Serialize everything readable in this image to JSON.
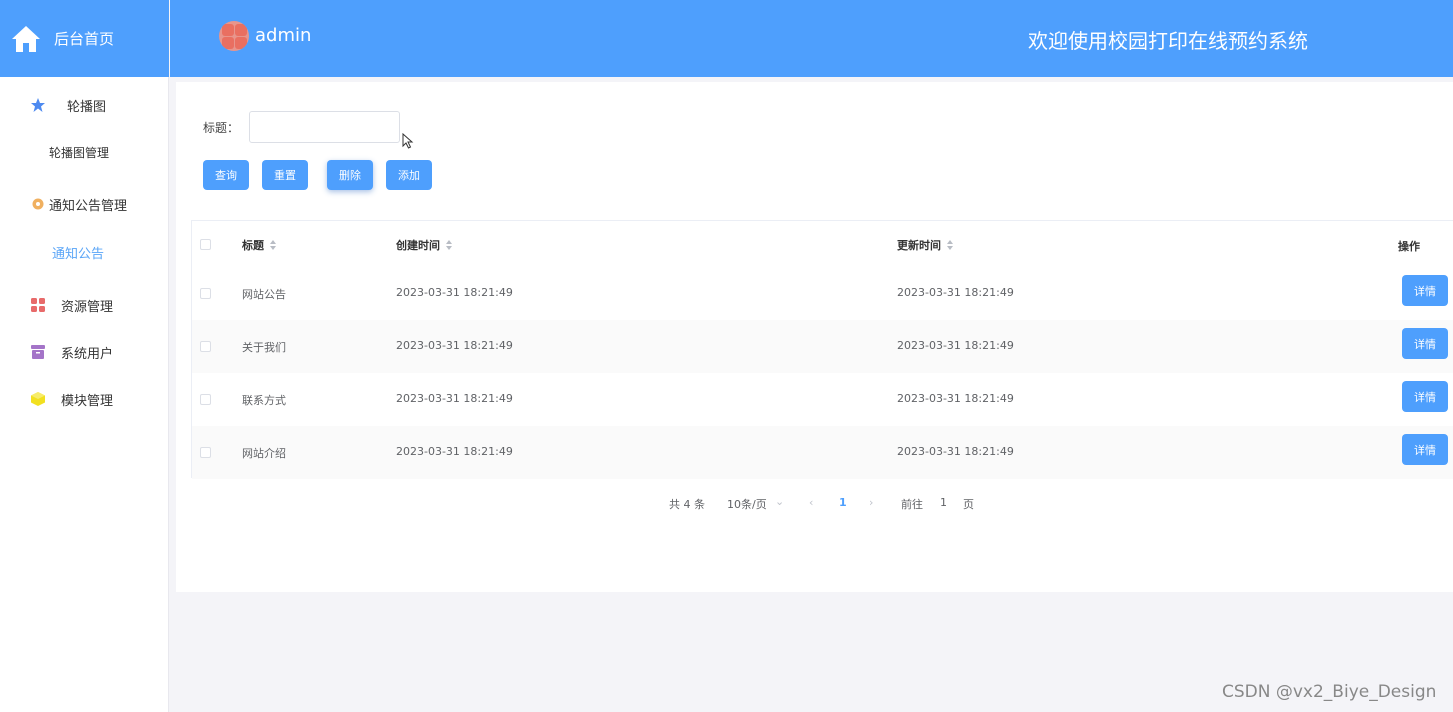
{
  "header": {
    "home_label": "后台首页",
    "admin_name": "admin",
    "system_title": "欢迎使用校园打印在线预约系统",
    "accent": "#4e9ffd"
  },
  "sidebar": {
    "items": [
      {
        "label": "轮播图",
        "icon": "star-icon",
        "color": "#4e8af0"
      },
      {
        "label": "轮播图管理",
        "type": "sub"
      },
      {
        "label": "通知公告管理",
        "icon": "gear-icon",
        "color": "#f0b060"
      },
      {
        "label": "通知公告",
        "type": "sub",
        "active": true
      },
      {
        "label": "资源管理",
        "icon": "grid-icon",
        "color": "#e86a6a"
      },
      {
        "label": "系统用户",
        "icon": "archive-icon",
        "color": "#a474c8"
      },
      {
        "label": "模块管理",
        "icon": "cube-icon",
        "color": "#f2e020"
      }
    ]
  },
  "search": {
    "label": "标题：",
    "value": ""
  },
  "toolbar": {
    "query": "查询",
    "reset": "重置",
    "delete": "删除",
    "add": "添加"
  },
  "table": {
    "columns": [
      "标题",
      "创建时间",
      "更新时间",
      "操作"
    ],
    "rows": [
      {
        "title": "网站公告",
        "created": "2023-03-31 18:21:49",
        "updated": "2023-03-31 18:21:49",
        "action": "详情"
      },
      {
        "title": "关于我们",
        "created": "2023-03-31 18:21:49",
        "updated": "2023-03-31 18:21:49",
        "action": "详情"
      },
      {
        "title": "联系方式",
        "created": "2023-03-31 18:21:49",
        "updated": "2023-03-31 18:21:49",
        "action": "详情"
      },
      {
        "title": "网站介绍",
        "created": "2023-03-31 18:21:49",
        "updated": "2023-03-31 18:21:49",
        "action": "详情"
      }
    ]
  },
  "pagination": {
    "total": "共 4 条",
    "page_size": "10条/页",
    "current": "1",
    "goto_label": "前往",
    "goto_value": "1",
    "page_unit": "页"
  },
  "watermark": "CSDN @vx2_Biye_Design"
}
